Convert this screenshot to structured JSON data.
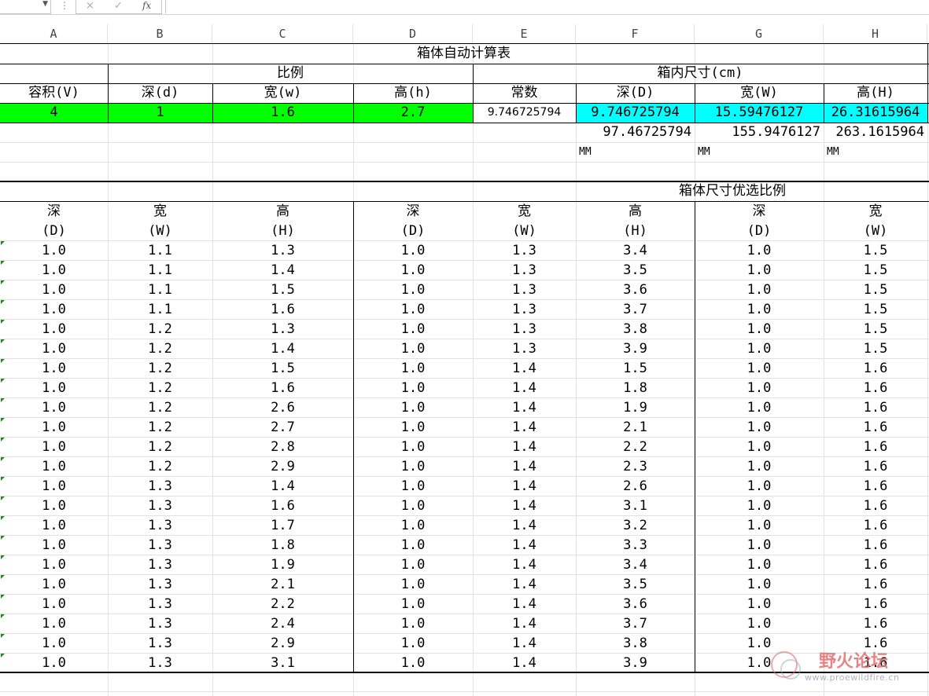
{
  "formula_bar": {
    "fx_label": "fx",
    "cancel_symbol": "×",
    "enter_symbol": "✓",
    "value": ""
  },
  "columns": [
    "A",
    "B",
    "C",
    "D",
    "E",
    "F",
    "G",
    "H"
  ],
  "calc": {
    "title": "箱体自动计算表",
    "ratio_header": "比例",
    "inner_size_header": "箱内尺寸(cm)",
    "labels": [
      "容积(V)",
      "深(d)",
      "宽(w)",
      "高(h)",
      "常数",
      "深(D)",
      "宽(W)",
      "高(H)"
    ],
    "values": [
      "4",
      "1",
      "1.6",
      "2.7",
      "9.746725794",
      "9.746725794",
      "15.59476127",
      "26.31615964"
    ],
    "mm_values": [
      "97.46725794",
      "155.9476127",
      "263.1615964"
    ],
    "mm_unit": "MM"
  },
  "preferred": {
    "title": "箱体尺寸优选比例",
    "headers": [
      [
        "深",
        "(D)"
      ],
      [
        "宽",
        "(W)"
      ],
      [
        "高",
        "(H)"
      ],
      [
        "深",
        "(D)"
      ],
      [
        "宽",
        "(W)"
      ],
      [
        "高",
        "(H)"
      ],
      [
        "深",
        "(D)"
      ],
      [
        "宽",
        "(W)"
      ]
    ],
    "rows": [
      [
        "1.0",
        "1.1",
        "1.3",
        "1.0",
        "1.3",
        "3.4",
        "1.0",
        "1.5"
      ],
      [
        "1.0",
        "1.1",
        "1.4",
        "1.0",
        "1.3",
        "3.5",
        "1.0",
        "1.5"
      ],
      [
        "1.0",
        "1.1",
        "1.5",
        "1.0",
        "1.3",
        "3.6",
        "1.0",
        "1.5"
      ],
      [
        "1.0",
        "1.1",
        "1.6",
        "1.0",
        "1.3",
        "3.7",
        "1.0",
        "1.5"
      ],
      [
        "1.0",
        "1.2",
        "1.3",
        "1.0",
        "1.3",
        "3.8",
        "1.0",
        "1.5"
      ],
      [
        "1.0",
        "1.2",
        "1.4",
        "1.0",
        "1.3",
        "3.9",
        "1.0",
        "1.5"
      ],
      [
        "1.0",
        "1.2",
        "1.5",
        "1.0",
        "1.4",
        "1.5",
        "1.0",
        "1.6"
      ],
      [
        "1.0",
        "1.2",
        "1.6",
        "1.0",
        "1.4",
        "1.8",
        "1.0",
        "1.6"
      ],
      [
        "1.0",
        "1.2",
        "2.6",
        "1.0",
        "1.4",
        "1.9",
        "1.0",
        "1.6"
      ],
      [
        "1.0",
        "1.2",
        "2.7",
        "1.0",
        "1.4",
        "2.1",
        "1.0",
        "1.6"
      ],
      [
        "1.0",
        "1.2",
        "2.8",
        "1.0",
        "1.4",
        "2.2",
        "1.0",
        "1.6"
      ],
      [
        "1.0",
        "1.2",
        "2.9",
        "1.0",
        "1.4",
        "2.3",
        "1.0",
        "1.6"
      ],
      [
        "1.0",
        "1.3",
        "1.4",
        "1.0",
        "1.4",
        "2.6",
        "1.0",
        "1.6"
      ],
      [
        "1.0",
        "1.3",
        "1.6",
        "1.0",
        "1.4",
        "3.1",
        "1.0",
        "1.6"
      ],
      [
        "1.0",
        "1.3",
        "1.7",
        "1.0",
        "1.4",
        "3.2",
        "1.0",
        "1.6"
      ],
      [
        "1.0",
        "1.3",
        "1.8",
        "1.0",
        "1.4",
        "3.3",
        "1.0",
        "1.6"
      ],
      [
        "1.0",
        "1.3",
        "1.9",
        "1.0",
        "1.4",
        "3.4",
        "1.0",
        "1.6"
      ],
      [
        "1.0",
        "1.3",
        "2.1",
        "1.0",
        "1.4",
        "3.5",
        "1.0",
        "1.6"
      ],
      [
        "1.0",
        "1.3",
        "2.2",
        "1.0",
        "1.4",
        "3.6",
        "1.0",
        "1.6"
      ],
      [
        "1.0",
        "1.3",
        "2.4",
        "1.0",
        "1.4",
        "3.7",
        "1.0",
        "1.6"
      ],
      [
        "1.0",
        "1.3",
        "2.9",
        "1.0",
        "1.4",
        "3.8",
        "1.0",
        "1.6"
      ],
      [
        "1.0",
        "1.3",
        "3.1",
        "1.0",
        "1.4",
        "3.9",
        "1.0",
        "1.6"
      ]
    ]
  },
  "watermark": {
    "text": "野火论坛",
    "url": "www.proewildfire.cn",
    "color": "#e07070"
  },
  "colors": {
    "green_fill": "#00ff00",
    "cyan_fill": "#00ffff"
  }
}
